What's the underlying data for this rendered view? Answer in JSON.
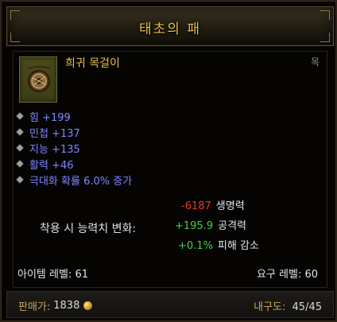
{
  "item": {
    "name": "태초의 패",
    "type": "희귀 목걸이",
    "slot": "목"
  },
  "stats": [
    "힘 +199",
    "민첩 +137",
    "지능 +135",
    "활력 +46",
    "극대화 확률 6.0% 증가"
  ],
  "comparison": {
    "label": "착용 시 능력치 변화:",
    "rows": [
      {
        "value": "-6187",
        "label": "생명력"
      },
      {
        "value": "+195.9",
        "label": "공격력"
      },
      {
        "value": "+0.1%",
        "label": "피해 감소"
      }
    ]
  },
  "levels": {
    "item_level": "아이템 레벨: 61",
    "required_level": "요구 레벨: 60"
  },
  "footer": {
    "sell_label": "판매가:",
    "sell_value": "1838",
    "durability_label": "내구도:",
    "durability_value": "45/45"
  },
  "colors": {
    "title": "#e8bf41",
    "magic_stat": "#7f86ff",
    "negative": "#e23a2a",
    "positive": "#3fd23c"
  },
  "icons": {
    "item": "amulet-icon",
    "currency": "gold-coin-icon",
    "stat_bullet": "diamond-bullet-icon"
  }
}
